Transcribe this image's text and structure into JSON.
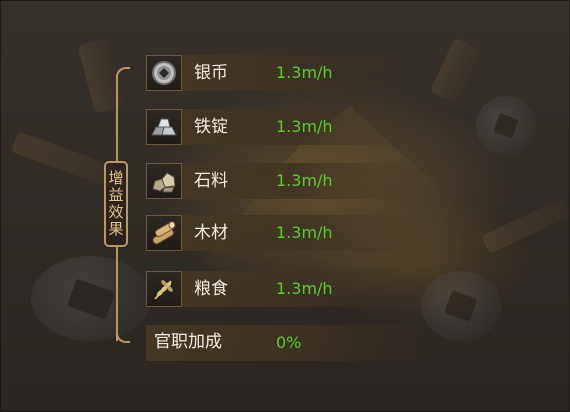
{
  "panel": {
    "section_label": "增益效果"
  },
  "resources": [
    {
      "name": "银币",
      "rate": "1.3m/h",
      "icon": "silver-coin-icon"
    },
    {
      "name": "铁锭",
      "rate": "1.3m/h",
      "icon": "iron-ingot-icon"
    },
    {
      "name": "石料",
      "rate": "1.3m/h",
      "icon": "stone-icon"
    },
    {
      "name": "木材",
      "rate": "1.3m/h",
      "icon": "wood-log-icon"
    },
    {
      "name": "粮食",
      "rate": "1.3m/h",
      "icon": "wheat-icon"
    }
  ],
  "bonus": {
    "label": "官职加成",
    "value": "0%"
  },
  "colors": {
    "rate_green": "#5dcc2a",
    "bracket_gold": "#b89866",
    "text_white": "#f2eee6"
  }
}
